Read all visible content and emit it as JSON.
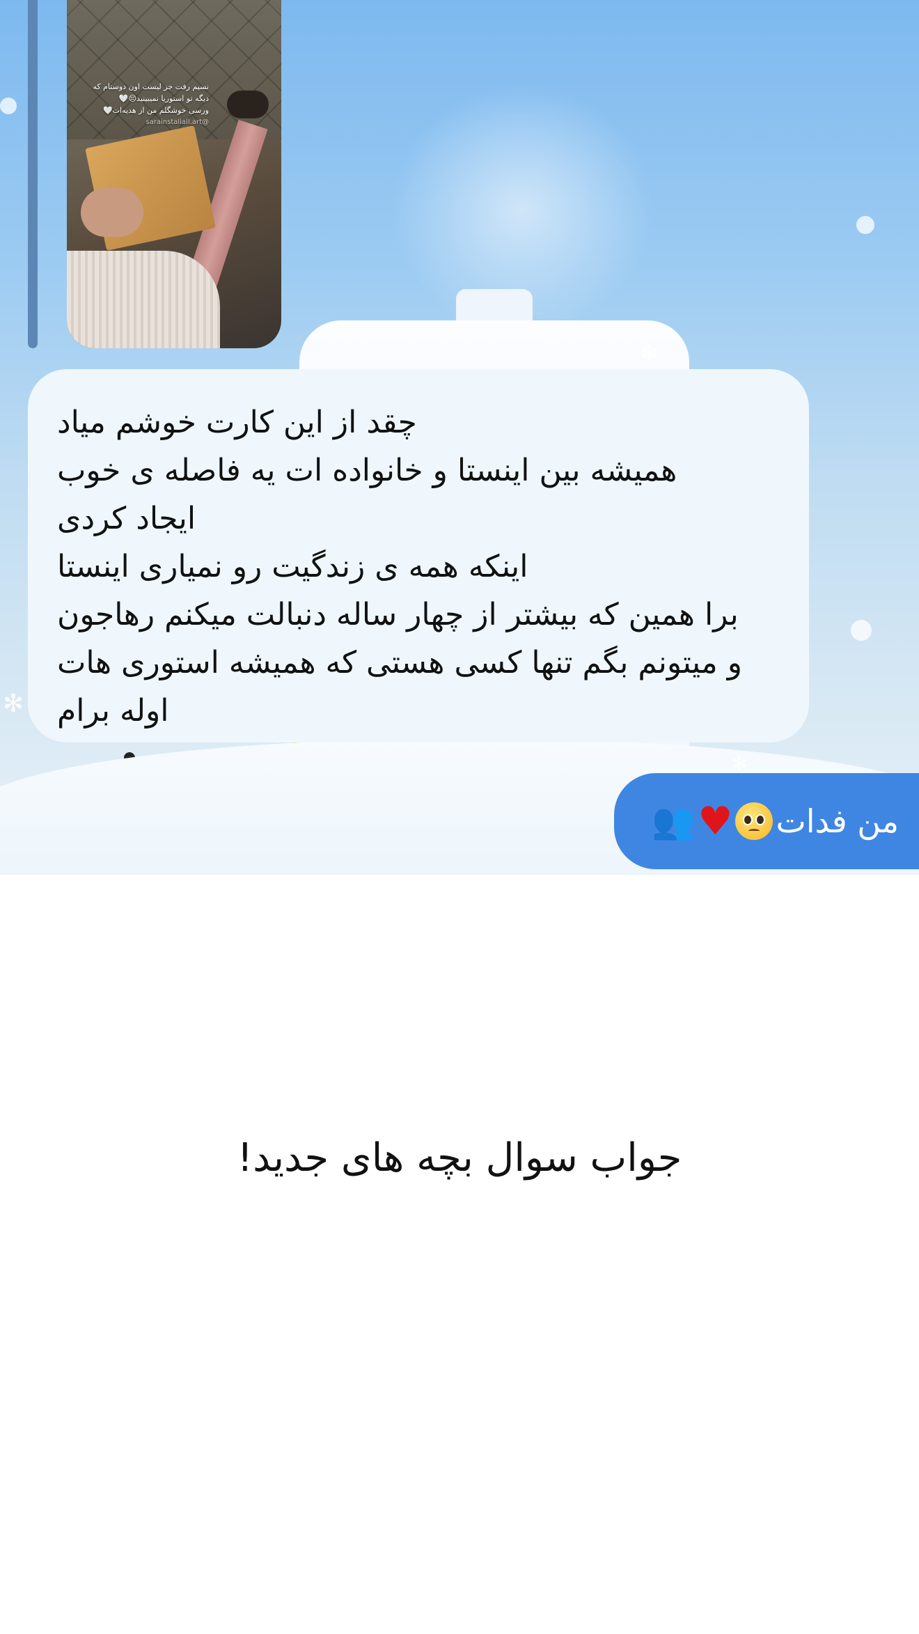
{
  "thread": {
    "story_reply": {
      "caption_line_1": "نسیم رفت جز لیست اون دوستام که",
      "caption_line_2": "دیگه تو استوریا نمیبینید😔🤍",
      "caption_line_3": "ورسی خوشگلم من از هدیه‌ات🤍",
      "caption_handle": "@sarainstaliall.art"
    },
    "received_message": {
      "lines": [
        "چقد از این کارت خوشم میاد",
        "همیشه بین اینستا و خانواده ات یه فاصله ی خوب",
        "ایجاد کردی",
        "اینکه همه ی زندگیت رو نمیاری اینستا",
        "برا همین که بیشتر از چهار ساله دنبالت میکنم رهاجون",
        "و میتونم بگم تنها کسی هستی که همیشه استوری هات",
        "اوله برام"
      ]
    },
    "sent_message": {
      "text": "من فدات",
      "emojis": [
        "pleading-face",
        "red-heart",
        "busts-in-silhouette"
      ],
      "heart_glyph": "♥",
      "silhouette_glyph": "👥"
    }
  },
  "footer": {
    "title": "جواب سوال بچه های جدید!"
  },
  "colors": {
    "sent_bubble": "#3f86e3",
    "received_bubble": "#eff7fc",
    "chat_background_top": "#7db9ef",
    "page_background": "#ffffff"
  }
}
